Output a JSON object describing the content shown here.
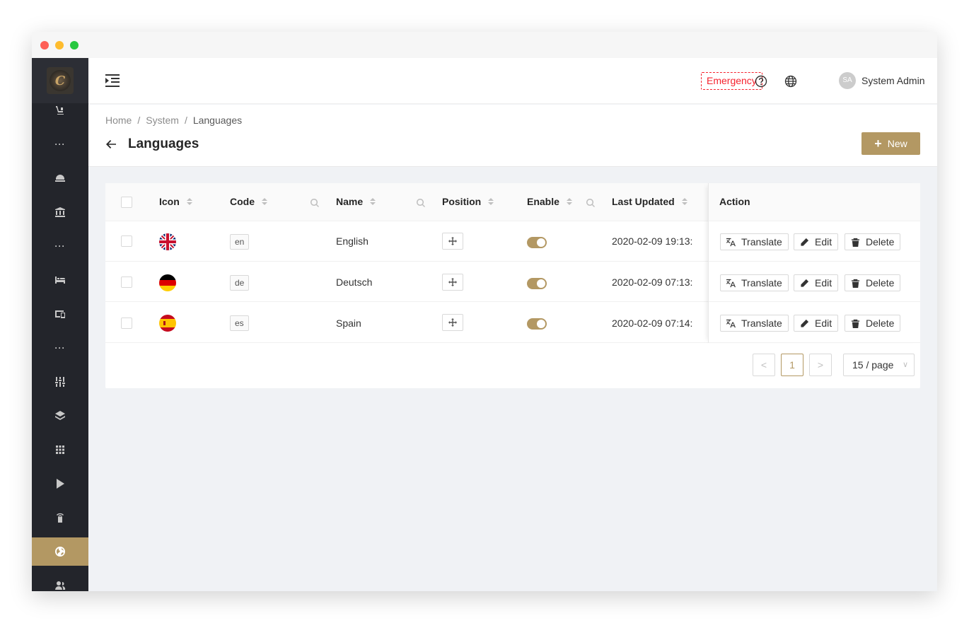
{
  "header": {
    "emergency_label": "Emergency",
    "user_initials": "SA",
    "user_name": "System Admin"
  },
  "breadcrumb": [
    "Home",
    "System",
    "Languages"
  ],
  "page": {
    "title": "Languages",
    "new_label": "New"
  },
  "table": {
    "columns": {
      "icon": "Icon",
      "code": "Code",
      "name": "Name",
      "position": "Position",
      "enable": "Enable",
      "last_updated": "Last Updated",
      "action": "Action"
    },
    "rows": [
      {
        "flag": "uk-flag-icon",
        "code": "en",
        "name": "English",
        "enabled": true,
        "last_updated": "2020-02-09 19:13:",
        "translate": "Translate",
        "edit": "Edit",
        "delete": "Delete"
      },
      {
        "flag": "germany-flag-icon",
        "code": "de",
        "name": "Deutsch",
        "enabled": true,
        "last_updated": "2020-02-09 07:13:",
        "translate": "Translate",
        "edit": "Edit",
        "delete": "Delete"
      },
      {
        "flag": "spain-flag-icon",
        "code": "es",
        "name": "Spain",
        "enabled": true,
        "last_updated": "2020-02-09 07:14:",
        "translate": "Translate",
        "edit": "Edit",
        "delete": "Delete"
      }
    ]
  },
  "pagination": {
    "prev": "<",
    "current": "1",
    "next": ">",
    "page_size": "15 / page"
  },
  "colors": {
    "accent": "#b39863",
    "sidebar": "#23252b",
    "emergency": "#f5222d"
  }
}
